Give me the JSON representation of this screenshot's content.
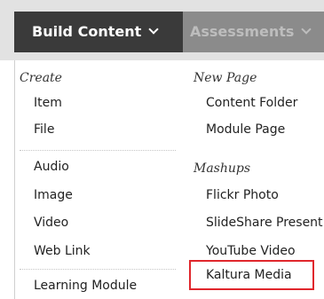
{
  "menubar": {
    "tabs": [
      {
        "label": "Build Content"
      },
      {
        "label": "Assessments"
      }
    ]
  },
  "dropdown": {
    "left": {
      "create_heading": "Create",
      "items_group1": [
        "Item",
        "File"
      ],
      "items_group2": [
        "Audio",
        "Image",
        "Video",
        "Web Link"
      ],
      "items_group3": [
        "Learning Module"
      ]
    },
    "right": {
      "new_page_heading": "New Page",
      "new_page_items": [
        "Content Folder",
        "Module Page"
      ],
      "mashups_heading": "Mashups",
      "mashups_items": [
        "Flickr Photo",
        "SlideShare Present",
        "YouTube Video",
        "Kaltura Media"
      ]
    }
  },
  "colors": {
    "active_tab_bg": "#3a3a3a",
    "inactive_tab_bg": "#8b8b8b",
    "highlight_border": "#e0262c"
  }
}
